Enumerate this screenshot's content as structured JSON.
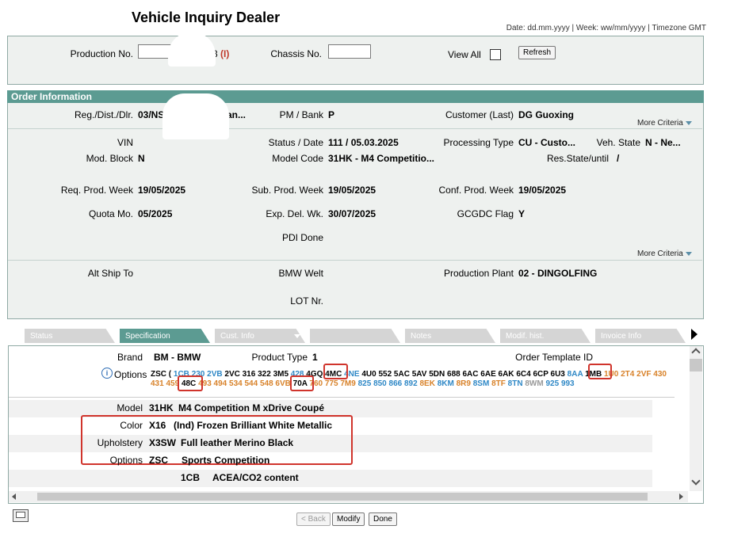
{
  "header": {
    "title": "Vehicle Inquiry Dealer",
    "date_hint": "Date: dd.mm.yyyy | Week: ww/mm/yyyy | Timezone GMT"
  },
  "search": {
    "production_no_label": "Production No.",
    "production_no_value": "",
    "production_no_suffix": "3",
    "production_no_marker": "(I)",
    "chassis_no_label": "Chassis No.",
    "chassis_no_value": "",
    "view_all_label": "View All",
    "refresh_label": "Refresh"
  },
  "order_info": {
    "heading": "Order Information",
    "more_criteria": "More Criteria",
    "reg_label": "Reg./Dist./Dlr.",
    "reg_value": "03/NS",
    "reg_value_tail": "an...",
    "pm_label": "PM / Bank",
    "pm_value": "P",
    "customer_label": "Customer (Last)",
    "customer_value": "DG Guoxing",
    "vin_label": "VIN",
    "vin_value": "",
    "status_label": "Status / Date",
    "status_value": "111 /  05.03.2025",
    "proc_type_label": "Processing Type",
    "proc_type_value": "CU - Custo...",
    "veh_state_label": "Veh. State",
    "veh_state_value": "N - Ne...",
    "mod_block_label": "Mod. Block",
    "mod_block_value": "N",
    "model_code_label": "Model Code",
    "model_code_value": "31HK - M4 Competitio...",
    "res_state_label": "Res.State/until",
    "res_state_value": "/",
    "req_week_label": "Req. Prod. Week",
    "req_week_value": "19/05/2025",
    "sub_week_label": "Sub. Prod. Week",
    "sub_week_value": "19/05/2025",
    "conf_week_label": "Conf. Prod. Week",
    "conf_week_value": "19/05/2025",
    "quota_label": "Quota Mo.",
    "quota_value": "05/2025",
    "exp_del_label": "Exp. Del. Wk.",
    "exp_del_value": "30/07/2025",
    "gcgdc_label": "GCGDC Flag",
    "gcgdc_value": "Y",
    "pdi_label": "PDI Done",
    "alt_ship_label": "Alt Ship To",
    "bmw_welt_label": "BMW Welt",
    "plant_label": "Production Plant",
    "plant_value": "02 - DINGOLFING",
    "lot_label": "LOT Nr."
  },
  "tabs": [
    "Status",
    "Specification",
    "Cust. Info",
    "",
    "Notes",
    "Modif. hist.",
    "Invoice Info"
  ],
  "spec": {
    "brand_label": "Brand",
    "brand_value": "BM - BMW",
    "product_type_label": "Product Type",
    "product_type_value": "1",
    "order_template_label": "Order Template ID",
    "options_label": "Options",
    "options_line1": [
      {
        "t": "ZSC (",
        "c": "k"
      },
      {
        "t": "1CB",
        "c": "b"
      },
      {
        "t": "230",
        "c": "b"
      },
      {
        "t": "2VB",
        "c": "b"
      },
      {
        "t": "2VC",
        "c": "k"
      },
      {
        "t": "316",
        "c": "k"
      },
      {
        "t": "322",
        "c": "k"
      },
      {
        "t": "3M5",
        "c": "k"
      },
      {
        "t": "428",
        "c": "b"
      },
      {
        "t": "4GQ",
        "c": "k"
      },
      {
        "t": "4MC",
        "c": "k"
      },
      {
        "t": "4NE",
        "c": "b"
      },
      {
        "t": "4U0",
        "c": "k"
      },
      {
        "t": "552",
        "c": "k"
      },
      {
        "t": "5AC",
        "c": "k"
      },
      {
        "t": "5AV",
        "c": "k"
      },
      {
        "t": "5DN",
        "c": "k"
      },
      {
        "t": "688",
        "c": "k"
      },
      {
        "t": "6AC",
        "c": "k"
      },
      {
        "t": "6AE",
        "c": "k"
      },
      {
        "t": "6AK",
        "c": "k"
      },
      {
        "t": "6C4",
        "c": "k"
      },
      {
        "t": "6CP",
        "c": "k"
      },
      {
        "t": "6U3",
        "c": "k"
      },
      {
        "t": "8AA",
        "c": "b"
      },
      {
        "t": "1MB",
        "c": "k"
      },
      {
        "t": "1U0",
        "c": "o"
      },
      {
        "t": "2T4",
        "c": "o"
      },
      {
        "t": "2VF",
        "c": "o"
      },
      {
        "t": "430",
        "c": "o"
      }
    ],
    "options_line2": [
      {
        "t": "431",
        "c": "o"
      },
      {
        "t": "459",
        "c": "o"
      },
      {
        "t": "48C",
        "c": "k"
      },
      {
        "t": "493",
        "c": "o"
      },
      {
        "t": "494",
        "c": "o"
      },
      {
        "t": "534",
        "c": "o"
      },
      {
        "t": "544",
        "c": "o"
      },
      {
        "t": "548",
        "c": "o"
      },
      {
        "t": "6VB",
        "c": "o"
      },
      {
        "t": "70A",
        "c": "k"
      },
      {
        "t": "760",
        "c": "o"
      },
      {
        "t": "775",
        "c": "o"
      },
      {
        "t": "7M9",
        "c": "o"
      },
      {
        "t": "825",
        "c": "b"
      },
      {
        "t": "850",
        "c": "b"
      },
      {
        "t": "866",
        "c": "b"
      },
      {
        "t": "892",
        "c": "b"
      },
      {
        "t": "8EK",
        "c": "o"
      },
      {
        "t": "8KM",
        "c": "b"
      },
      {
        "t": "8R9",
        "c": "o"
      },
      {
        "t": "8SM",
        "c": "b"
      },
      {
        "t": "8TF",
        "c": "o"
      },
      {
        "t": "8TN",
        "c": "b"
      },
      {
        "t": "8WM",
        "c": "g"
      },
      {
        "t": "925",
        "c": "b"
      },
      {
        "t": "993",
        "c": "b"
      }
    ],
    "model_label": "Model",
    "model_code": "31HK",
    "model_desc": "M4 Competition M xDrive Coupé",
    "color_label": "Color",
    "color_code": "X16",
    "color_desc": "(Ind) Frozen Brilliant White Metallic",
    "upholstery_label": "Upholstery",
    "upholstery_code": "X3SW",
    "upholstery_desc": "Full leather Merino Black",
    "options2_label": "Options",
    "options2_code": "ZSC",
    "options2_desc": "Sports Competition",
    "extra_code": "1CB",
    "extra_desc": "ACEA/CO2 content"
  },
  "footer": {
    "back_label": "< Back",
    "modify_label": "Modify",
    "done_label": "Done"
  },
  "colors": {
    "accent": "#5c9b92",
    "highlight": "#d0342c"
  }
}
